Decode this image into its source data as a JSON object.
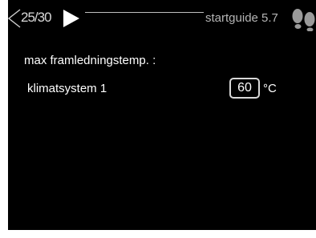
{
  "header": {
    "page_counter": "25/30",
    "title": "startguide 5.7",
    "icons": [
      "nav-prev-icon",
      "nav-next-icon",
      "footprints-icon"
    ]
  },
  "main": {
    "heading": "max framledningstemp. :",
    "setting": {
      "label": "klimatsystem 1",
      "value": "60",
      "unit": "°C"
    }
  },
  "colors": {
    "background": "#000000",
    "text": "#ffffff",
    "muted_text": "#b5b5b5",
    "accent_white": "#ffffff"
  }
}
